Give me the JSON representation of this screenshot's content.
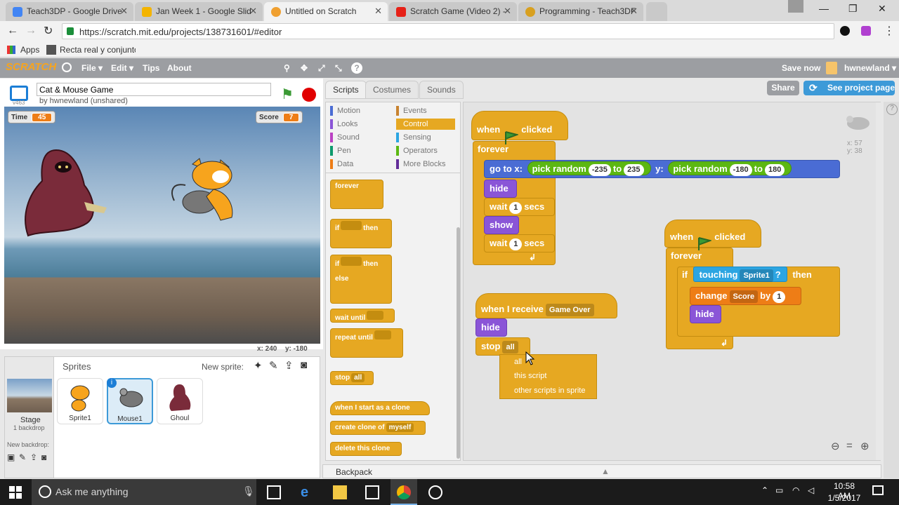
{
  "browser": {
    "tabs": [
      {
        "title": "Teach3DP - Google Drive"
      },
      {
        "title": "Jan Week 1 - Google Slid"
      },
      {
        "title": "Untitled on Scratch"
      },
      {
        "title": "Scratch Game (Video 2) -"
      },
      {
        "title": "Programming - Teach3DF"
      }
    ],
    "url": "https://scratch.mit.edu/projects/138731601/#editor",
    "bookmarks": [
      "Apps",
      "Recta real y conjuntos"
    ]
  },
  "scratch": {
    "menu": [
      "File ▾",
      "Edit ▾",
      "Tips",
      "About"
    ],
    "save_now": "Save now",
    "username": "hwnewland ▾",
    "share": "Share",
    "see_project": "See project page",
    "project_title": "Cat & Mouse Game",
    "author": "by hwnewland (unshared)",
    "version": "v463",
    "monitors": [
      {
        "label": "Time",
        "value": "45"
      },
      {
        "label": "Score",
        "value": "7"
      }
    ],
    "mouse_readout": {
      "x": "x: 240",
      "y": "y: -180"
    },
    "tabs": [
      "Scripts",
      "Costumes",
      "Sounds"
    ],
    "categories_left": [
      "Motion",
      "Looks",
      "Sound",
      "Pen",
      "Data"
    ],
    "categories_right": [
      "Events",
      "Control",
      "Sensing",
      "Operators",
      "More Blocks"
    ],
    "category_colors": {
      "Motion": "#4a6cd4",
      "Looks": "#8a55d7",
      "Sound": "#bb42c3",
      "Pen": "#0e9a6c",
      "Data": "#ee7d16",
      "Events": "#c88330",
      "Control": "#e6a822",
      "Sensing": "#2ca5e2",
      "Operators": "#5cb712",
      "More Blocks": "#632d99"
    },
    "palette_blocks": {
      "forever": "forever",
      "if": "if",
      "then": "then",
      "else": "else",
      "wait_until": "wait until",
      "repeat_until": "repeat until",
      "stop": "stop",
      "stop_opt": "all",
      "when_clone": "when I start as a clone",
      "create_clone": "create clone of",
      "create_clone_opt": "myself",
      "delete_clone": "delete this clone"
    },
    "sprite_coords": {
      "x": "x: 57",
      "y": "y: 38"
    },
    "script1": {
      "hat": "when",
      "hat_end": "clicked",
      "forever": "forever",
      "goto": "go to x:",
      "pick": "pick random",
      "to": "to",
      "y": "y:",
      "x_from": "-235",
      "x_to": "235",
      "y_from": "-180",
      "y_to": "180",
      "hide": "hide",
      "wait": "wait",
      "secs": "secs",
      "wait_val": "1",
      "show": "show"
    },
    "script2": {
      "hat": "when I receive",
      "msg": "Game Over",
      "hide": "hide",
      "stop": "stop",
      "stop_val": "all"
    },
    "script3": {
      "hat": "when",
      "hat_end": "clicked",
      "forever": "forever",
      "if": "if",
      "touching": "touching",
      "target": "Sprite1",
      "q": "?",
      "then": "then",
      "change": "change",
      "var": "Score",
      "by": "by",
      "val": "1",
      "hide": "hide"
    },
    "stop_dropdown": [
      "all",
      "this script",
      "other scripts in sprite"
    ],
    "sprites_title": "Sprites",
    "new_sprite": "New sprite:",
    "stage_label": "Stage",
    "stage_backdrops": "1 backdrop",
    "new_backdrop": "New backdrop:",
    "sprites": [
      {
        "name": "Sprite1"
      },
      {
        "name": "Mouse1"
      },
      {
        "name": "Ghoul"
      }
    ],
    "backpack": "Backpack"
  },
  "taskbar": {
    "search": "Ask me anything",
    "time": "10:58 AM",
    "date": "1/5/2017"
  }
}
